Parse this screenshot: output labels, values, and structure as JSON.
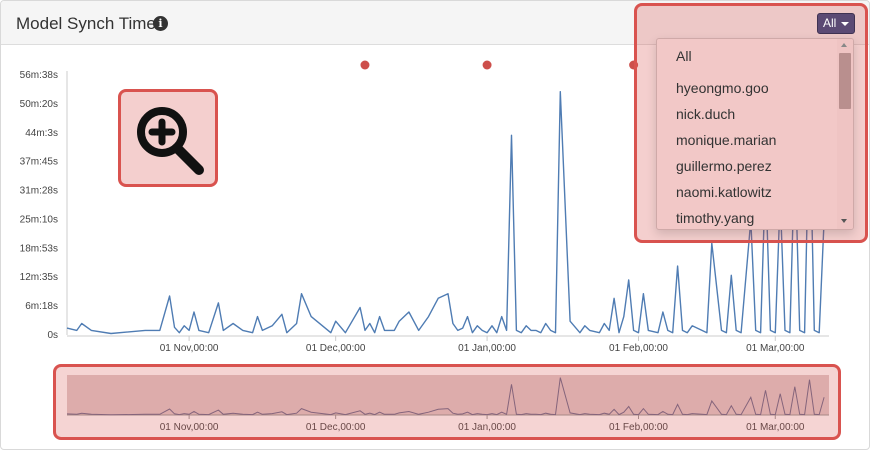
{
  "header": {
    "title": "Model Synch Time",
    "info_icon": "info-circle-icon"
  },
  "filter": {
    "selected": "All",
    "options": [
      "All",
      "hyeongmo.goo",
      "nick.duch",
      "monique.marian",
      "guillermo.perez",
      "naomi.katlowitz",
      "timothy.yang"
    ]
  },
  "zoom": {
    "icon": "zoom-in-icon"
  },
  "colors": {
    "series": "#4f7cb3",
    "accent": "#d9534f",
    "marker": "#cd4f4b",
    "button": "#5b4a74"
  },
  "chart_data": {
    "type": "line",
    "title": "Model Synch Time",
    "ylabel": "",
    "xlabel": "",
    "y_ticks": [
      "0s",
      "6m:18s",
      "12m:35s",
      "18m:53s",
      "25m:10s",
      "31m:28s",
      "37m:45s",
      "44m:3s",
      "50m:20s",
      "56m:38s"
    ],
    "x_ticks": [
      "01 Nov,00:00",
      "01 Dec,00:00",
      "01 Jan,00:00",
      "01 Feb,00:00",
      "01 Mar,00:00"
    ],
    "ylim": [
      "0s",
      "56m:38s"
    ],
    "xlim": [
      "2017-10-07",
      "2018-03-12"
    ],
    "grid": false,
    "markers_date": [
      "2017-12-07",
      "2018-01-01",
      "2018-01-31"
    ],
    "series": [
      {
        "x": [
          "2017-10-07",
          "2017-10-09",
          "2017-10-10",
          "2017-10-12",
          "2017-10-16",
          "2017-10-23",
          "2017-10-26",
          "2017-10-28",
          "2017-10-29",
          "2017-10-30",
          "2017-10-31",
          "2017-11-01",
          "2017-11-02",
          "2017-11-03",
          "2017-11-05",
          "2017-11-07",
          "2017-11-08",
          "2017-11-10",
          "2017-11-12",
          "2017-11-14",
          "2017-11-15",
          "2017-11-16",
          "2017-11-18",
          "2017-11-20",
          "2017-11-21",
          "2017-11-23",
          "2017-11-24",
          "2017-11-26",
          "2017-11-30",
          "2017-12-01",
          "2017-12-03",
          "2017-12-06",
          "2017-12-07",
          "2017-12-08",
          "2017-12-09",
          "2017-12-10",
          "2017-12-11",
          "2017-12-13",
          "2017-12-14",
          "2017-12-16",
          "2017-12-18",
          "2017-12-20",
          "2017-12-22",
          "2017-12-24",
          "2017-12-25",
          "2017-12-26",
          "2017-12-27",
          "2017-12-28",
          "2017-12-29",
          "2017-12-30",
          "2017-12-31",
          "2018-01-01",
          "2018-01-02",
          "2018-01-03",
          "2018-01-04",
          "2018-01-05",
          "2018-01-06",
          "2018-01-07",
          "2018-01-08",
          "2018-01-09",
          "2018-01-10",
          "2018-01-11",
          "2018-01-12",
          "2018-01-13",
          "2018-01-14",
          "2018-01-15",
          "2018-01-16",
          "2018-01-18",
          "2018-01-20",
          "2018-01-21",
          "2018-01-22",
          "2018-01-24",
          "2018-01-25",
          "2018-01-26",
          "2018-01-27",
          "2018-01-28",
          "2018-01-29",
          "2018-01-30",
          "2018-01-31",
          "2018-02-01",
          "2018-02-02",
          "2018-02-03",
          "2018-02-05",
          "2018-02-06",
          "2018-02-07",
          "2018-02-08",
          "2018-02-09",
          "2018-02-10",
          "2018-02-11",
          "2018-02-12",
          "2018-02-14",
          "2018-02-15",
          "2018-02-16",
          "2018-02-18",
          "2018-02-19",
          "2018-02-20",
          "2018-02-21",
          "2018-02-22",
          "2018-02-24",
          "2018-02-25",
          "2018-02-26",
          "2018-02-27",
          "2018-02-28",
          "2018-03-01",
          "2018-03-02",
          "2018-03-03",
          "2018-03-04",
          "2018-03-05",
          "2018-03-06",
          "2018-03-07",
          "2018-03-08",
          "2018-03-09",
          "2018-03-10",
          "2018-03-11"
        ],
        "y_seconds": [
          90,
          60,
          150,
          60,
          20,
          60,
          60,
          510,
          100,
          30,
          120,
          60,
          300,
          60,
          30,
          420,
          60,
          150,
          60,
          30,
          240,
          60,
          120,
          270,
          30,
          150,
          540,
          240,
          30,
          180,
          30,
          360,
          60,
          150,
          30,
          240,
          60,
          60,
          180,
          300,
          60,
          240,
          480,
          540,
          150,
          60,
          90,
          240,
          30,
          120,
          60,
          30,
          120,
          30,
          240,
          60,
          2610,
          60,
          30,
          120,
          60,
          60,
          30,
          150,
          60,
          30,
          3180,
          180,
          30,
          120,
          60,
          30,
          150,
          60,
          480,
          30,
          240,
          720,
          60,
          30,
          540,
          60,
          30,
          300,
          60,
          30,
          900,
          60,
          30,
          120,
          60,
          30,
          1200,
          60,
          30,
          780,
          60,
          30,
          1500,
          60,
          30,
          2100,
          60,
          30,
          1800,
          60,
          30,
          2400,
          60,
          30,
          3000,
          60,
          30,
          1500
        ]
      }
    ]
  },
  "navigator": {
    "x_ticks": [
      "01 Nov,00:00",
      "01 Dec,00:00",
      "01 Jan,00:00",
      "01 Feb,00:00",
      "01 Mar,00:00"
    ]
  }
}
